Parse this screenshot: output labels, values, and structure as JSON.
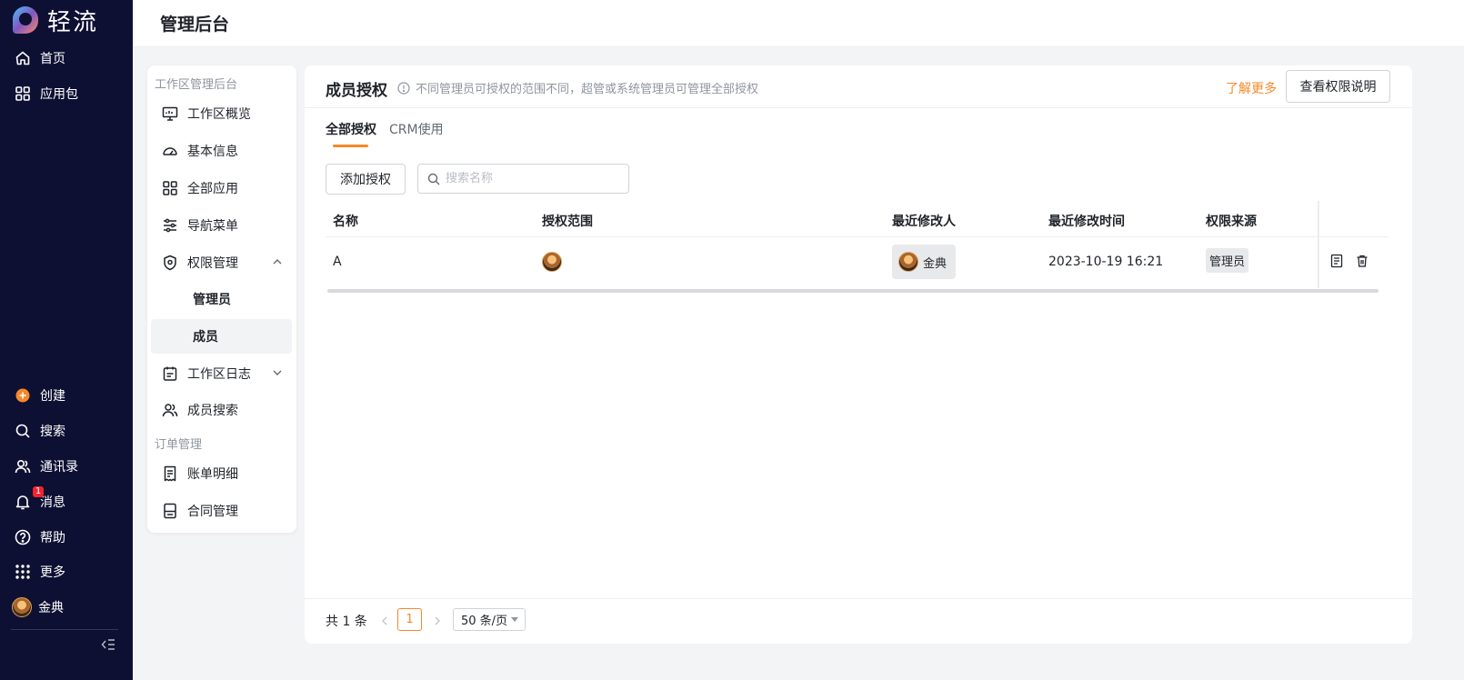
{
  "app": {
    "name": "轻流",
    "header_title": "管理后台"
  },
  "sidebar": {
    "top_items": [
      {
        "label": "首页",
        "icon": "home-icon"
      },
      {
        "label": "应用包",
        "icon": "grid-icon"
      }
    ],
    "bottom_items": [
      {
        "label": "创建",
        "icon": "plus-circle-icon"
      },
      {
        "label": "搜索",
        "icon": "search-icon"
      },
      {
        "label": "通讯录",
        "icon": "contacts-icon"
      },
      {
        "label": "消息",
        "icon": "bell-icon",
        "badge": "1"
      },
      {
        "label": "帮助",
        "icon": "help-icon"
      },
      {
        "label": "更多",
        "icon": "dots-grid-icon"
      },
      {
        "label": "金典",
        "icon": "avatar"
      }
    ]
  },
  "submenu": {
    "group1_label": "工作区管理后台",
    "items": [
      {
        "label": "工作区概览",
        "icon": "monitor-icon"
      },
      {
        "label": "基本信息",
        "icon": "gauge-icon"
      },
      {
        "label": "全部应用",
        "icon": "grid-icon"
      },
      {
        "label": "导航菜单",
        "icon": "sliders-icon"
      },
      {
        "label": "权限管理",
        "icon": "shield-icon"
      },
      {
        "label": "工作区日志",
        "icon": "calendar-icon"
      },
      {
        "label": "成员搜索",
        "icon": "users-icon"
      }
    ],
    "perm_children": [
      "管理员",
      "成员"
    ],
    "group2_label": "订单管理",
    "order_items": [
      {
        "label": "账单明细",
        "icon": "receipt-icon"
      },
      {
        "label": "合同管理",
        "icon": "contract-icon"
      }
    ]
  },
  "main": {
    "title": "成员授权",
    "hint": "不同管理员可授权的范围不同，超管或系统管理员可管理全部授权",
    "learn_more": "了解更多",
    "perm_button": "查看权限说明",
    "tabs": [
      "全部授权",
      "CRM使用"
    ],
    "add_button": "添加授权",
    "search_placeholder": "搜索名称",
    "columns": [
      "名称",
      "授权范围",
      "最近修改人",
      "最近修改时间",
      "权限来源"
    ],
    "rows": [
      {
        "name": "A",
        "modifier": "金典",
        "modified_time": "2023-10-19 16:21",
        "source": "管理员"
      }
    ],
    "pagination": {
      "total": "共 1 条",
      "page": "1",
      "page_size": "50 条/页"
    }
  },
  "colors": {
    "accent": "#f5892a",
    "sidebar_bg": "#0e1033",
    "badge": "#f5222d"
  }
}
